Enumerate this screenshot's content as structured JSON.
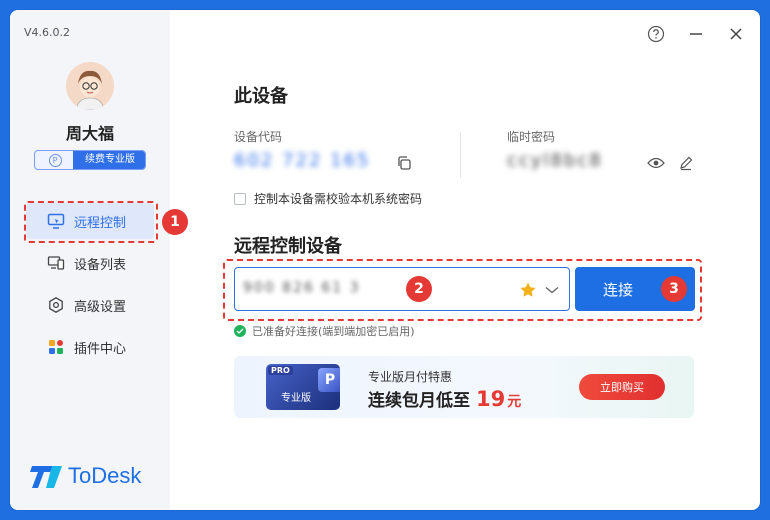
{
  "app": {
    "version": "V4.6.0.2",
    "logo_text": "ToDesk"
  },
  "user": {
    "name": "周大福",
    "badge_mark": "P",
    "badge_label": "续费专业版"
  },
  "nav": {
    "items": [
      {
        "label": "远程控制",
        "icon": "monitor-remote-icon",
        "active": true
      },
      {
        "label": "设备列表",
        "icon": "device-list-icon",
        "active": false
      },
      {
        "label": "高级设置",
        "icon": "gear-icon",
        "active": false
      },
      {
        "label": "插件中心",
        "icon": "plugin-grid-icon",
        "active": false
      }
    ]
  },
  "this_device": {
    "title": "此设备",
    "code_label": "设备代码",
    "code_value": "602 722 165",
    "password_label": "临时密码",
    "password_value": "ccyl8bc8",
    "check_label": "控制本设备需校验本机系统密码"
  },
  "remote": {
    "title": "远程控制设备",
    "input_value": "900 826 61 3",
    "connect_label": "连接",
    "status_text": "已准备好连接(端到端加密已启用)"
  },
  "annotations": {
    "step1": "1",
    "step2": "2",
    "step3": "3",
    "color": "#e53935"
  },
  "promo": {
    "card_tag": "PRO",
    "card_mark": "P",
    "card_name": "专业版",
    "line1": "专业版月付特惠",
    "line2": "连续包月低至",
    "price": "19",
    "unit": "元",
    "buy_label": "立即购买"
  },
  "colors": {
    "accent": "#1e6fe3",
    "sidebar_bg": "#f3f5f9",
    "success": "#21b35b"
  }
}
